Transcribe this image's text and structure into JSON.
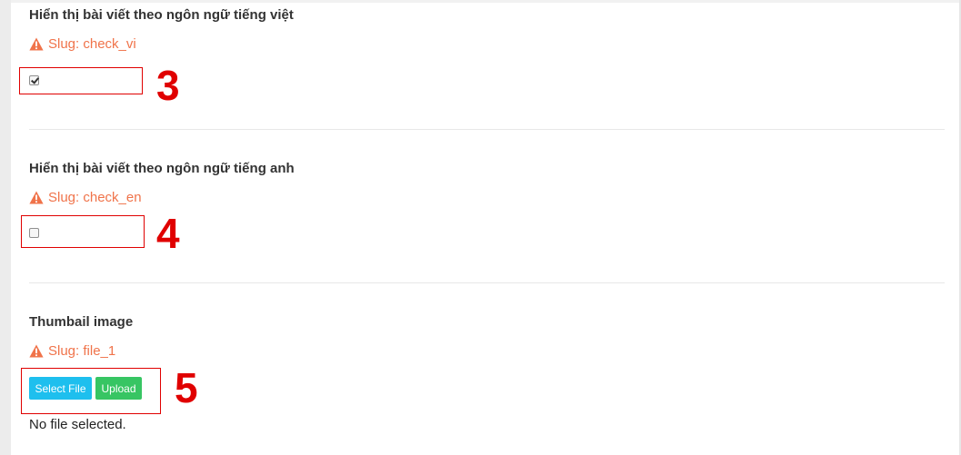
{
  "fields": [
    {
      "title": "Hiển thị bài viết theo ngôn ngữ tiếng việt",
      "slug": "Slug: check_vi",
      "checked": true,
      "annotation": "3"
    },
    {
      "title": "Hiển thị bài viết theo ngôn ngữ tiếng anh",
      "slug": "Slug: check_en",
      "checked": false,
      "annotation": "4"
    },
    {
      "title": "Thumbail image",
      "slug": "Slug: file_1",
      "select_button": "Select File",
      "upload_button": "Upload",
      "status": "No file selected.",
      "annotation": "5"
    }
  ],
  "colors": {
    "slug": "#f0734a",
    "annotation": "#e00000",
    "select_button": "#1ebfee",
    "upload_button": "#37c563"
  },
  "icons": {
    "slug_icon": "warning-icon"
  }
}
